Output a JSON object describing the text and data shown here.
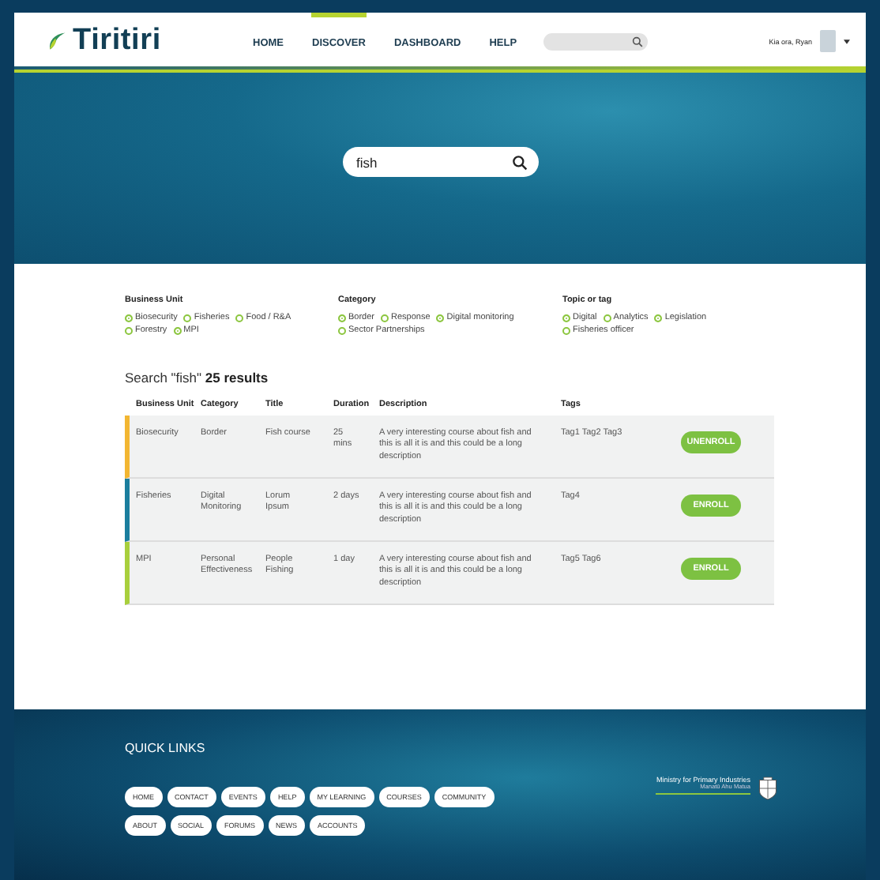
{
  "header": {
    "logo": "Tiritiri",
    "nav": [
      {
        "label": "HOME",
        "selected": false
      },
      {
        "label": "DISCOVER",
        "selected": true
      },
      {
        "label": "DASHBOARD",
        "selected": false
      },
      {
        "label": "HELP",
        "selected": false
      }
    ],
    "greeting": "Kia ora, Ryan"
  },
  "hero": {
    "search_value": "fish"
  },
  "filters": [
    {
      "title": "Business Unit",
      "options": [
        {
          "label": "Biosecurity",
          "selected": true
        },
        {
          "label": "Fisheries",
          "selected": false
        },
        {
          "label": "Food / R&A",
          "selected": false
        },
        {
          "label": "Forestry",
          "selected": false
        },
        {
          "label": "MPI",
          "selected": true
        }
      ]
    },
    {
      "title": "Category",
      "options": [
        {
          "label": "Border",
          "selected": true
        },
        {
          "label": "Response",
          "selected": false
        },
        {
          "label": "Digital monitoring",
          "selected": true
        },
        {
          "label": "Sector Partnerships",
          "selected": false
        }
      ]
    },
    {
      "title": "Topic or tag",
      "options": [
        {
          "label": "Digital",
          "selected": true
        },
        {
          "label": "Analytics",
          "selected": false
        },
        {
          "label": "Legislation",
          "selected": true
        },
        {
          "label": "Fisheries officer",
          "selected": false
        }
      ]
    }
  ],
  "results": {
    "heading": "Search \"fish\" **25 results**",
    "columns": [
      "Business Unit",
      "Category",
      "Title",
      "Duration",
      "Description",
      "Tags"
    ],
    "rows": [
      {
        "color": "#f2b632",
        "cells": [
          "Biosecurity",
          "Border",
          "Fish course",
          "25 mins",
          "A very interesting course about fish and this is all it is and this could be a long description",
          "Tag1 Tag2 Tag3"
        ],
        "action": "UNENROLL"
      },
      {
        "color": "#1b7e9e",
        "cells": [
          "Fisheries",
          "Digital Monitoring",
          "Lorum Ipsum",
          "2 days",
          "A very interesting course about fish and this is all it is and this could be a long description",
          "Tag4"
        ],
        "action": "ENROLL"
      },
      {
        "color": "#a8cf3c",
        "cells": [
          "MPI",
          "Personal Effectiveness",
          "People Fishing",
          "1 day",
          "A very interesting course about fish and this is all it is and this could be a long description",
          "Tag5 Tag6"
        ],
        "action": "ENROLL"
      }
    ]
  },
  "footer": {
    "title": "QUICK LINKS",
    "links": [
      "HOME",
      "CONTACT",
      "EVENTS",
      "HELP",
      "MY LEARNING",
      "COURSES",
      "COMMUNITY",
      "ABOUT",
      "SOCIAL",
      "FORUMS",
      "NEWS",
      "ACCOUNTS"
    ],
    "ministry": "Ministry for Primary Industries",
    "ministry_sub": "Manatū Ahu Matua"
  }
}
